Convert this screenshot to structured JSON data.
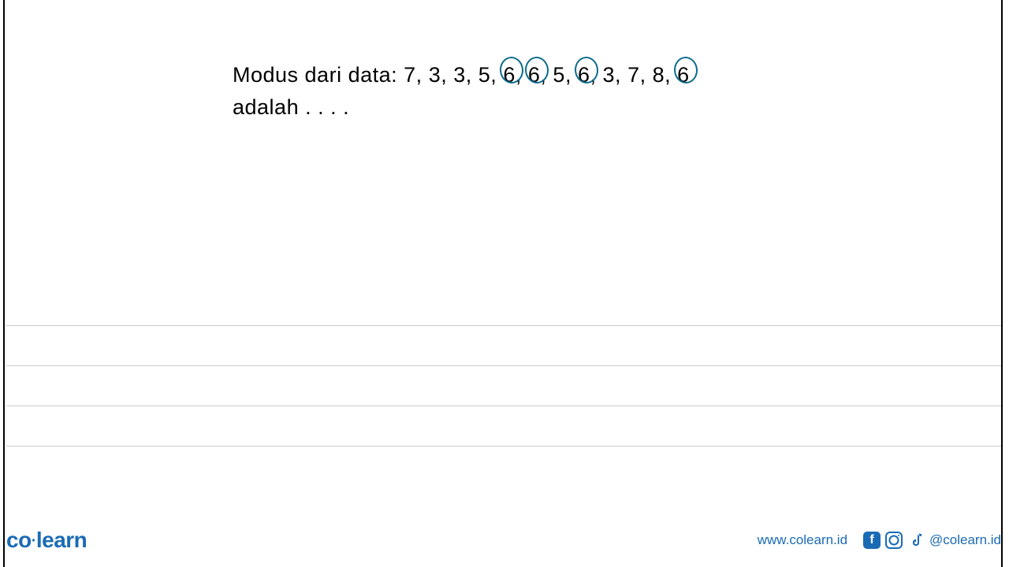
{
  "question": {
    "prefix": "Modus  dari  data:",
    "data_items": [
      {
        "value": "7,",
        "circled": false
      },
      {
        "value": "3,",
        "circled": false
      },
      {
        "value": "3,",
        "circled": false
      },
      {
        "value": "5,",
        "circled": false
      },
      {
        "value": "6,",
        "circled": true
      },
      {
        "value": "6,",
        "circled": true
      },
      {
        "value": "5,",
        "circled": false
      },
      {
        "value": "6,",
        "circled": true
      },
      {
        "value": "3,",
        "circled": false
      },
      {
        "value": "7,",
        "circled": false
      },
      {
        "value": "8,",
        "circled": false
      },
      {
        "value": "6",
        "circled": true
      }
    ],
    "suffix": "adalah . . . ."
  },
  "footer": {
    "logo_part1": "co",
    "logo_part2": "learn",
    "website": "www.colearn.id",
    "handle": "@colearn.id"
  }
}
